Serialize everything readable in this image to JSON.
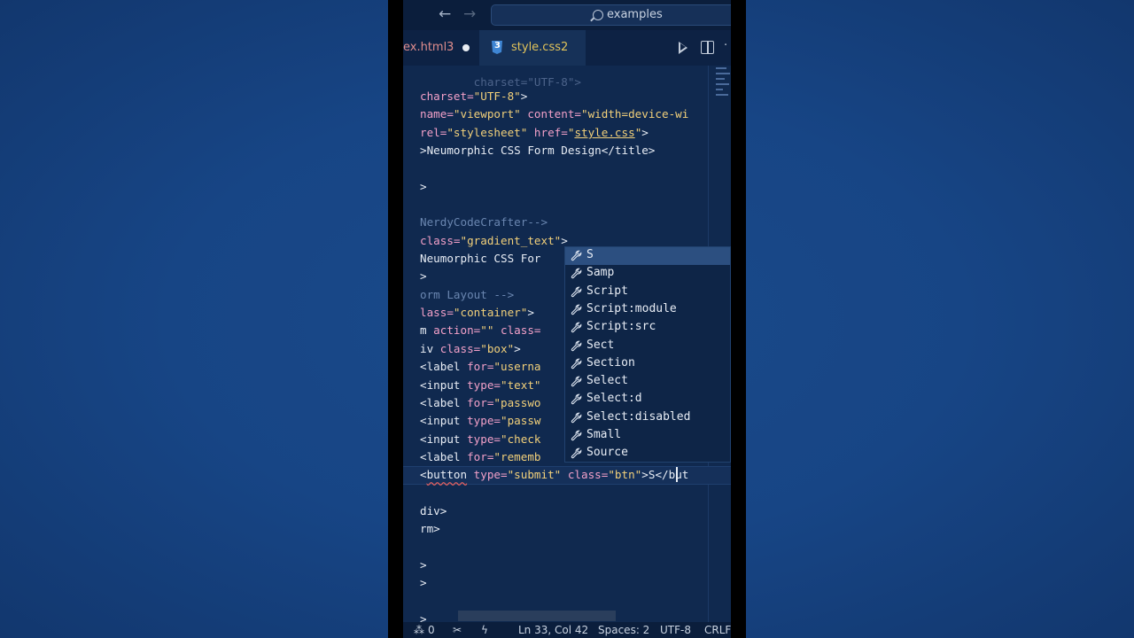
{
  "titlebar": {
    "back_icon": "←",
    "forward_icon": "→",
    "search_text": "examples"
  },
  "tabs": [
    {
      "name": "ex.html",
      "problems": "3",
      "dirty": true
    },
    {
      "name": "style.css",
      "problems": "2",
      "dirty": false
    }
  ],
  "editor_actions": {
    "more": "·"
  },
  "code": {
    "line_top_partial": "charset=\"UTF-8\">",
    "lines": [
      "charset=\"UTF-8\">",
      "name=\"viewport\" content=\"width=device-wi",
      "rel=\"stylesheet\" href=\"style.css\">",
      ">Neumorphic CSS Form Design</title>",
      ">",
      "NerdyCodeCrafter-->",
      "class=\"gradient_text\">",
      "Neumorphic CSS For",
      ">",
      "orm Layout -->",
      "lass=\"container\">",
      "m action=\"\" class=",
      "iv class=\"box\">",
      "<label for=\"userna",
      "<input type=\"text\"",
      "<label for=\"passwo",
      "<input type=\"passw",
      "<input type=\"check",
      "<label for=\"rememb",
      "<button type=\"submit\" class=\"btn\">S</but",
      "div>",
      "rm>",
      ">",
      ">",
      ">"
    ]
  },
  "suggestions": [
    "S",
    "Samp",
    "Script",
    "Script:module",
    "Script:src",
    "Sect",
    "Section",
    "Select",
    "Select:d",
    "Select:disabled",
    "Small",
    "Source"
  ],
  "status": {
    "ports": "0",
    "line_col": "Ln 33, Col 42",
    "spaces": "Spaces: 2",
    "encoding": "UTF-8",
    "eol": "CRLF"
  }
}
